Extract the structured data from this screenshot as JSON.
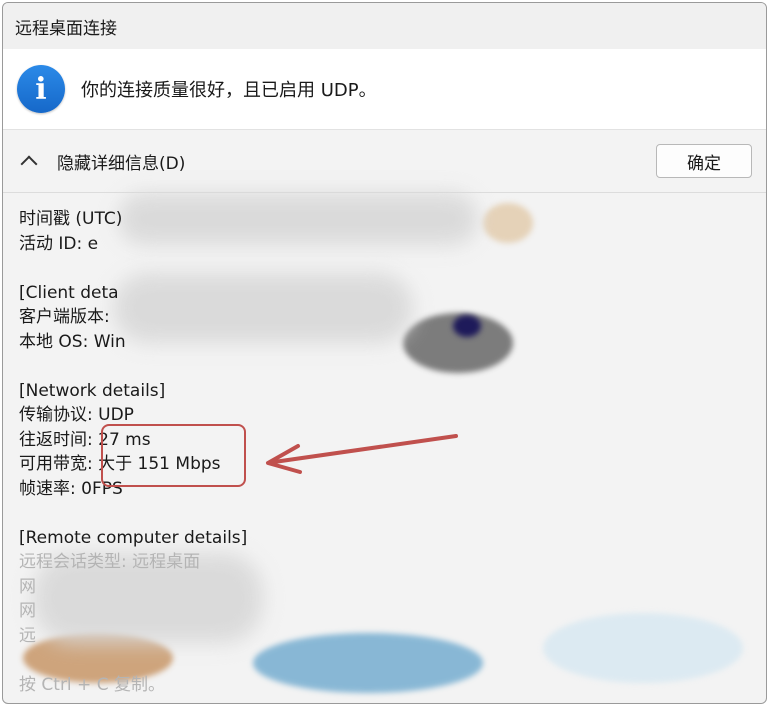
{
  "window": {
    "title": "远程桌面连接"
  },
  "message": {
    "text": "你的连接质量很好，且已启用 UDP。",
    "icon": "info-icon"
  },
  "details_bar": {
    "toggle_label": "隐藏详细信息(D)",
    "ok_label": "确定"
  },
  "details": {
    "timestamp_label": "时间戳 (UTC)",
    "activity_label": "活动 ID: e",
    "client_header": "[Client deta",
    "client_version_label": "客户端版本:",
    "local_os_label": "本地 OS: Win",
    "network_header": "[Network details]",
    "transport_label": "传输协议: UDP",
    "rtt_label": "往返时间: ",
    "rtt_value": "27 ms",
    "bandwidth_label": "可用带宽: ",
    "bandwidth_value": "大于 151 Mbps",
    "fps_label": "帧速率: 0FPS",
    "remote_header": "[Remote computer details]",
    "session_type_label": "远程会话类型: 远程桌面",
    "faded_line_1": "网",
    "faded_line_2": "网",
    "faded_line_3": "远",
    "copy_hint": "按 Ctrl + C 复制。"
  },
  "colors": {
    "accent": "#1f78d8",
    "annotation": "#c0504d"
  }
}
